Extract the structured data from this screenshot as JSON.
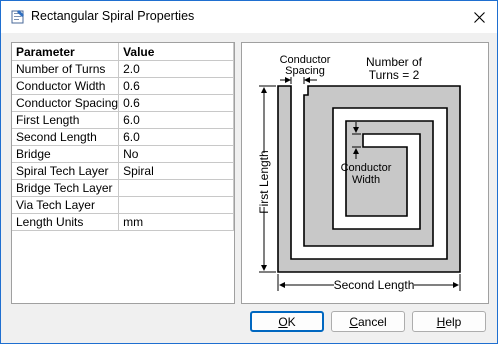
{
  "window": {
    "title": "Rectangular Spiral Properties"
  },
  "grid": {
    "headers": [
      "Parameter",
      "Value"
    ],
    "rows": [
      {
        "param": "Number of Turns",
        "value": "2.0"
      },
      {
        "param": "Conductor Width",
        "value": "0.6"
      },
      {
        "param": "Conductor Spacing",
        "value": "0.6"
      },
      {
        "param": "First Length",
        "value": "6.0"
      },
      {
        "param": "Second Length",
        "value": "6.0"
      },
      {
        "param": "Bridge",
        "value": "No"
      },
      {
        "param": "Spiral Tech Layer",
        "value": "Spiral"
      },
      {
        "param": "Bridge Tech Layer",
        "value": ""
      },
      {
        "param": "Via Tech Layer",
        "value": ""
      },
      {
        "param": "Length Units",
        "value": "mm"
      }
    ]
  },
  "diagram": {
    "conductor_spacing_line1": "Conductor",
    "conductor_spacing_line2": "Spacing",
    "turns_line1": "Number of",
    "turns_line2": "Turns = 2",
    "conductor_width_line1": "Conductor",
    "conductor_width_line2": "Width",
    "first_length": "First Length",
    "second_length": "Second Length",
    "trace_color": "#c8c8c8"
  },
  "buttons": {
    "ok_mnemonic": "O",
    "ok_rest": "K",
    "cancel_mnemonic": "C",
    "cancel_rest": "ancel",
    "help_mnemonic": "H",
    "help_rest": "elp"
  },
  "colors": {
    "accent": "#0067c0",
    "window_border": "#1f6fd0"
  }
}
